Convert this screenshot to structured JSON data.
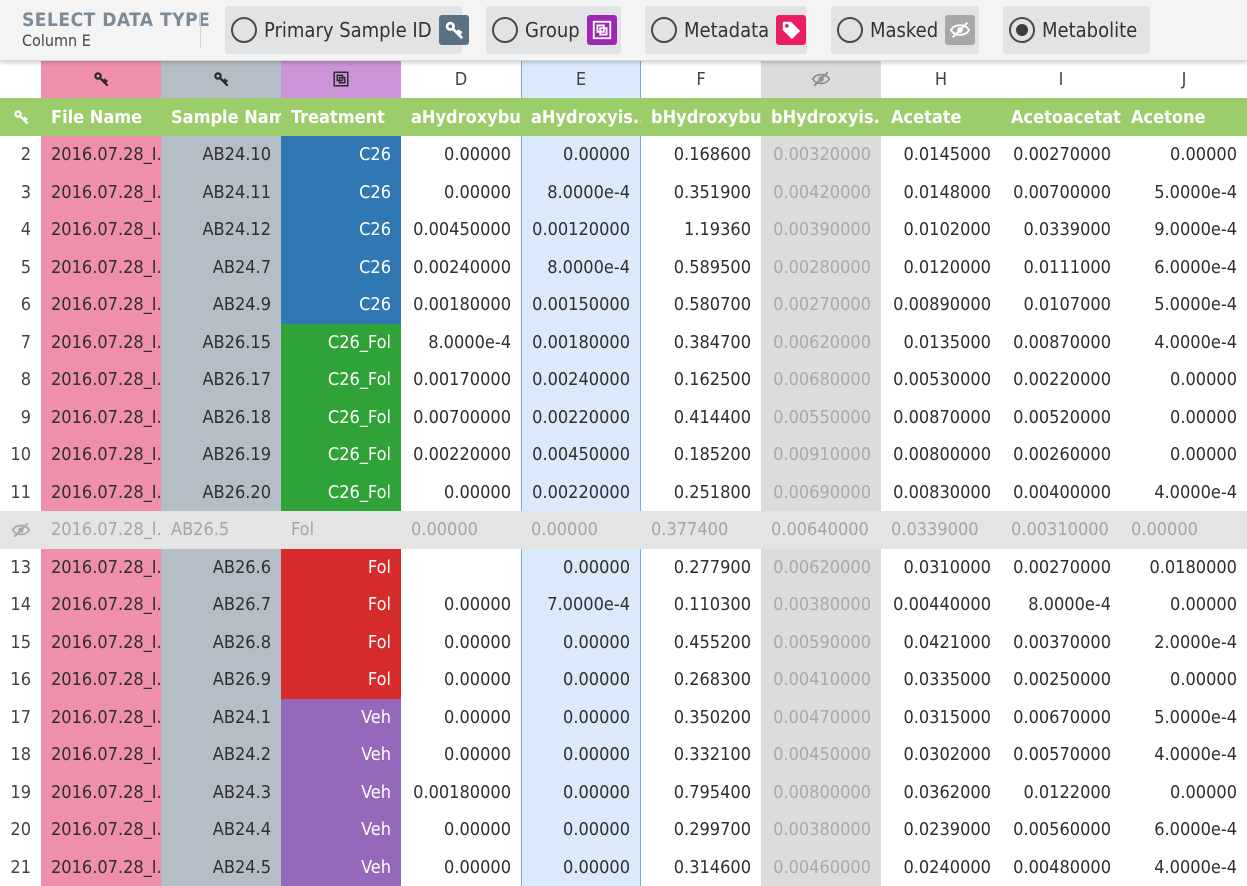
{
  "toolbar": {
    "title": "SELECT DATA TYPE",
    "subtitle": "Column E",
    "options": [
      {
        "label": "Primary Sample ID",
        "icon": "key-icon",
        "icon_bg": "#5a7184",
        "selected": false
      },
      {
        "label": "Group",
        "icon": "group-icon",
        "icon_bg": "#9c27b0",
        "selected": false
      },
      {
        "label": "Metadata",
        "icon": "tag-icon",
        "icon_bg": "#e91e63",
        "selected": false
      },
      {
        "label": "Masked",
        "icon": "eye-off-icon",
        "icon_bg": "#a7a7a7",
        "selected": false
      },
      {
        "label": "Metabolite",
        "icon": "",
        "icon_bg": "",
        "selected": true
      }
    ]
  },
  "colors": {
    "header_bar": "#9ccd6b",
    "file_name_col": "#f08fac",
    "sample_name_col": "#b5bec6",
    "treatment_header": "#cd93d8",
    "selected_col": "#dbeafa",
    "selected_col_border": "#6eaee6",
    "masked_col": "#dcdcdc",
    "masked_row": "#e4e4e4",
    "treat_C26": "#2f78b4",
    "treat_C26_Fol": "#2fa238",
    "treat_Fol": "#d62b2b",
    "treat_Veh": "#9468bb"
  },
  "table": {
    "column_letters": [
      "",
      "key-icon",
      "key-icon",
      "group-icon",
      "D",
      "E",
      "F",
      "eye-off-icon",
      "H",
      "I",
      "J"
    ],
    "header_names": [
      "File Name",
      "Sample Name",
      "Treatment",
      "aHydroxybu...",
      "aHydroxyis...",
      "bHydroxybu...",
      "bHydroxyis...",
      "Acetate",
      "Acetoacetate",
      "Acetone"
    ],
    "rows": [
      {
        "idx": "2",
        "file": "2016.07.28_I...",
        "sample": "AB24.10",
        "treatment": "C26",
        "v": [
          "0.00000",
          "0.00000",
          "0.168600",
          "0.00320000",
          "0.0145000",
          "0.00270000",
          "0.00000"
        ]
      },
      {
        "idx": "3",
        "file": "2016.07.28_I...",
        "sample": "AB24.11",
        "treatment": "C26",
        "v": [
          "0.00000",
          "8.0000e-4",
          "0.351900",
          "0.00420000",
          "0.0148000",
          "0.00700000",
          "5.0000e-4"
        ]
      },
      {
        "idx": "4",
        "file": "2016.07.28_I...",
        "sample": "AB24.12",
        "treatment": "C26",
        "v": [
          "0.00450000",
          "0.00120000",
          "1.19360",
          "0.00390000",
          "0.0102000",
          "0.0339000",
          "9.0000e-4"
        ]
      },
      {
        "idx": "5",
        "file": "2016.07.28_I...",
        "sample": "AB24.7",
        "treatment": "C26",
        "v": [
          "0.00240000",
          "8.0000e-4",
          "0.589500",
          "0.00280000",
          "0.0120000",
          "0.0111000",
          "6.0000e-4"
        ]
      },
      {
        "idx": "6",
        "file": "2016.07.28_I...",
        "sample": "AB24.9",
        "treatment": "C26",
        "v": [
          "0.00180000",
          "0.00150000",
          "0.580700",
          "0.00270000",
          "0.00890000",
          "0.0107000",
          "5.0000e-4"
        ]
      },
      {
        "idx": "7",
        "file": "2016.07.28_I...",
        "sample": "AB26.15",
        "treatment": "C26_Fol",
        "v": [
          "8.0000e-4",
          "0.00180000",
          "0.384700",
          "0.00620000",
          "0.0135000",
          "0.00870000",
          "4.0000e-4"
        ]
      },
      {
        "idx": "8",
        "file": "2016.07.28_I...",
        "sample": "AB26.17",
        "treatment": "C26_Fol",
        "v": [
          "0.00170000",
          "0.00240000",
          "0.162500",
          "0.00680000",
          "0.00530000",
          "0.00220000",
          "0.00000"
        ]
      },
      {
        "idx": "9",
        "file": "2016.07.28_I...",
        "sample": "AB26.18",
        "treatment": "C26_Fol",
        "v": [
          "0.00700000",
          "0.00220000",
          "0.414400",
          "0.00550000",
          "0.00870000",
          "0.00520000",
          "0.00000"
        ]
      },
      {
        "idx": "10",
        "file": "2016.07.28_I...",
        "sample": "AB26.19",
        "treatment": "C26_Fol",
        "v": [
          "0.00220000",
          "0.00450000",
          "0.185200",
          "0.00910000",
          "0.00800000",
          "0.00260000",
          "0.00000"
        ]
      },
      {
        "idx": "11",
        "file": "2016.07.28_I...",
        "sample": "AB26.20",
        "treatment": "C26_Fol",
        "v": [
          "0.00000",
          "0.00220000",
          "0.251800",
          "0.00690000",
          "0.00830000",
          "0.00400000",
          "4.0000e-4"
        ]
      },
      {
        "idx": "",
        "masked": true,
        "file": "2016.07.28_I...",
        "sample": "AB26.5",
        "treatment": "Fol",
        "v": [
          "0.00000",
          "0.00000",
          "0.377400",
          "0.00640000",
          "0.0339000",
          "0.00310000",
          "0.00000"
        ]
      },
      {
        "idx": "13",
        "file": "2016.07.28_I...",
        "sample": "AB26.6",
        "treatment": "Fol",
        "v": [
          "",
          "0.00000",
          "0.277900",
          "0.00620000",
          "0.0310000",
          "0.00270000",
          "0.0180000"
        ]
      },
      {
        "idx": "14",
        "file": "2016.07.28_I...",
        "sample": "AB26.7",
        "treatment": "Fol",
        "v": [
          "0.00000",
          "7.0000e-4",
          "0.110300",
          "0.00380000",
          "0.00440000",
          "8.0000e-4",
          "0.00000"
        ]
      },
      {
        "idx": "15",
        "file": "2016.07.28_I...",
        "sample": "AB26.8",
        "treatment": "Fol",
        "v": [
          "0.00000",
          "0.00000",
          "0.455200",
          "0.00590000",
          "0.0421000",
          "0.00370000",
          "2.0000e-4"
        ]
      },
      {
        "idx": "16",
        "file": "2016.07.28_I...",
        "sample": "AB26.9",
        "treatment": "Fol",
        "v": [
          "0.00000",
          "0.00000",
          "0.268300",
          "0.00410000",
          "0.0335000",
          "0.00250000",
          "0.00000"
        ]
      },
      {
        "idx": "17",
        "file": "2016.07.28_I...",
        "sample": "AB24.1",
        "treatment": "Veh",
        "v": [
          "0.00000",
          "0.00000",
          "0.350200",
          "0.00470000",
          "0.0315000",
          "0.00670000",
          "5.0000e-4"
        ]
      },
      {
        "idx": "18",
        "file": "2016.07.28_I...",
        "sample": "AB24.2",
        "treatment": "Veh",
        "v": [
          "0.00000",
          "0.00000",
          "0.332100",
          "0.00450000",
          "0.0302000",
          "0.00570000",
          "4.0000e-4"
        ]
      },
      {
        "idx": "19",
        "file": "2016.07.28_I...",
        "sample": "AB24.3",
        "treatment": "Veh",
        "v": [
          "0.00180000",
          "0.00000",
          "0.795400",
          "0.00800000",
          "0.0362000",
          "0.0122000",
          "0.00000"
        ]
      },
      {
        "idx": "20",
        "file": "2016.07.28_I...",
        "sample": "AB24.4",
        "treatment": "Veh",
        "v": [
          "0.00000",
          "0.00000",
          "0.299700",
          "0.00380000",
          "0.0239000",
          "0.00560000",
          "6.0000e-4"
        ]
      },
      {
        "idx": "21",
        "file": "2016.07.28_I...",
        "sample": "AB24.5",
        "treatment": "Veh",
        "v": [
          "0.00000",
          "0.00000",
          "0.314600",
          "0.00460000",
          "0.0240000",
          "0.00480000",
          "4.0000e-4"
        ]
      }
    ]
  }
}
